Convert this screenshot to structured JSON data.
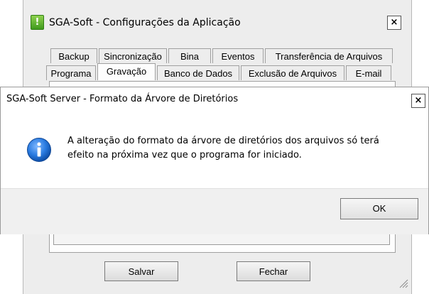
{
  "main_window": {
    "title": "SGA-Soft - Configurações da Aplicação",
    "close_glyph": "×",
    "app_icon_glyph": "!",
    "tabs_row1": [
      "Backup",
      "Sincronização",
      "Bina",
      "Eventos",
      "Transferência de Arquivos"
    ],
    "tabs_row2": [
      "Programa",
      "Gravação",
      "Banco de Dados",
      "Exclusão de Arquivos",
      "E-mail"
    ],
    "selected_tab": "Gravação",
    "save_label": "Salvar",
    "close_label": "Fechar"
  },
  "dialog": {
    "title": "SGA-Soft Server - Formato da Árvore de Diretórios",
    "close_glyph": "×",
    "icon": "info-icon",
    "message_line1": "A alteração do formato da árvore de diretórios dos arquivos só terá",
    "message_line2": "efeito na próxima vez que o programa for iniciado.",
    "ok_label": "OK"
  },
  "colors": {
    "info_icon": "#1c6fd1",
    "app_icon": "#5bb22f"
  }
}
